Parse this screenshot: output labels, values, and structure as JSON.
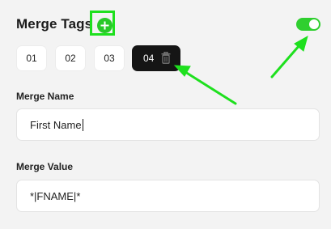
{
  "header": {
    "title": "Merge Tags",
    "add_icon": "plus-circle-icon",
    "toggle_on": true
  },
  "tabs": [
    {
      "label": "01",
      "active": false
    },
    {
      "label": "02",
      "active": false
    },
    {
      "label": "03",
      "active": false
    },
    {
      "label": "04",
      "active": true,
      "icon": "trash-icon"
    }
  ],
  "fields": {
    "name": {
      "label": "Merge Name",
      "value": "First Name"
    },
    "value": {
      "label": "Merge Value",
      "value": "*|FNAME|*"
    }
  },
  "colors": {
    "accent": "#2fcf2f",
    "highlight": "#1ee01e",
    "active_tab": "#151515"
  }
}
